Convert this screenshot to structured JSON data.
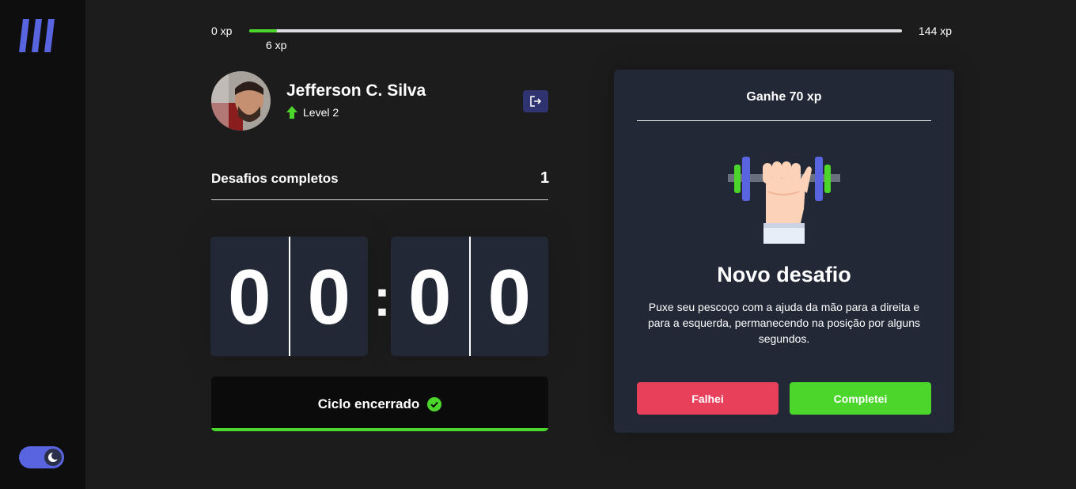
{
  "app": {
    "logo": "stripes-logo",
    "theme_toggle": {
      "state": "dark",
      "icon": "moon-icon"
    }
  },
  "xp_bar": {
    "start_label": "0 xp",
    "end_label": "144 xp",
    "current_label": "6 xp",
    "progress_fraction": 0.042,
    "fill_color": "#4cd62b"
  },
  "profile": {
    "name": "Jefferson C. Silva",
    "level_label": "Level 2",
    "level_icon": "level-up-arrow-icon",
    "logout_icon": "logout-icon"
  },
  "challenges": {
    "label": "Desafios completos",
    "count": "1"
  },
  "countdown": {
    "minute_left": "0",
    "minute_right": "0",
    "separator": ":",
    "second_left": "0",
    "second_right": "0"
  },
  "cycle_button": {
    "label": "Ciclo encerrado",
    "icon": "check-circle-icon"
  },
  "challenge_card": {
    "reward": "Ganhe 70 xp",
    "illustration": "dumbbell-hand-icon",
    "title": "Novo desafio",
    "description": "Puxe seu pescoço com a ajuda da mão para a direita e para a esquerda, permanecendo na posição por alguns segundos.",
    "fail_label": "Falhei",
    "success_label": "Completei"
  },
  "colors": {
    "accent": "#5965e0",
    "success": "#4cd62b",
    "danger": "#e83f5b",
    "card_bg": "#222836",
    "page_bg": "#1c1c1c"
  }
}
